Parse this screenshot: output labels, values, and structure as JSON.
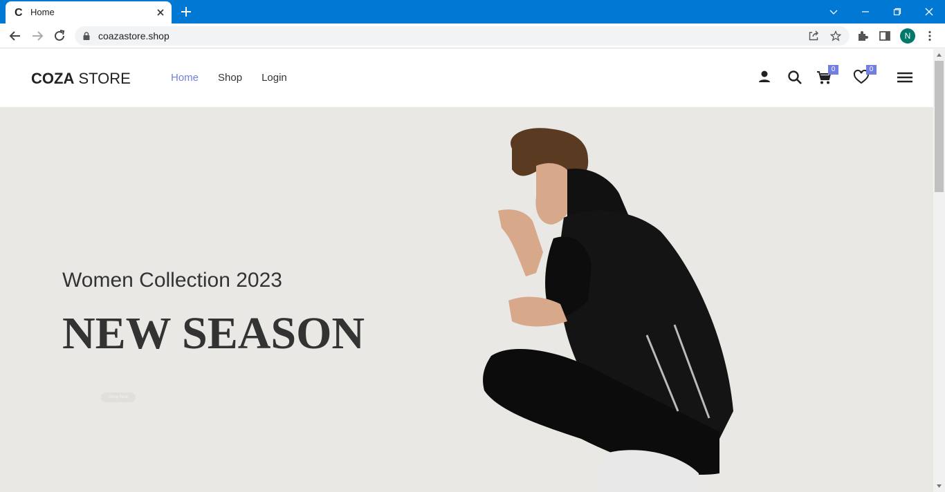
{
  "browser": {
    "tab": {
      "title": "Home",
      "favicon_letter": "C"
    },
    "url": "coazastore.shop",
    "profile_initial": "N",
    "icons": [
      "back-icon",
      "forward-icon",
      "reload-icon",
      "lock-icon",
      "share-icon",
      "star-icon",
      "extensions-icon",
      "sidepanel-icon",
      "menu-dots-icon",
      "new-tab-icon",
      "close-icon",
      "minimize-icon",
      "maximize-icon",
      "chevron-down-icon"
    ],
    "colors": {
      "tabstrip": "#0078d4",
      "profile": "#00796b"
    }
  },
  "site": {
    "logo": {
      "bold": "COZA",
      "regular": " STORE"
    },
    "nav": [
      {
        "label": "Home",
        "active": true
      },
      {
        "label": "Shop",
        "active": false
      },
      {
        "label": "Login",
        "active": false
      }
    ],
    "header_icons": [
      "user-icon",
      "search-icon",
      "cart-icon",
      "heart-icon",
      "hamburger-icon"
    ],
    "cart_count": "0",
    "wishlist_count": "0",
    "accent_color": "#717fe0"
  },
  "hero": {
    "subtitle": "Women Collection 2023",
    "title": "NEW SEASON",
    "button_label": "Shop Now",
    "background": "#e9e8e4"
  }
}
